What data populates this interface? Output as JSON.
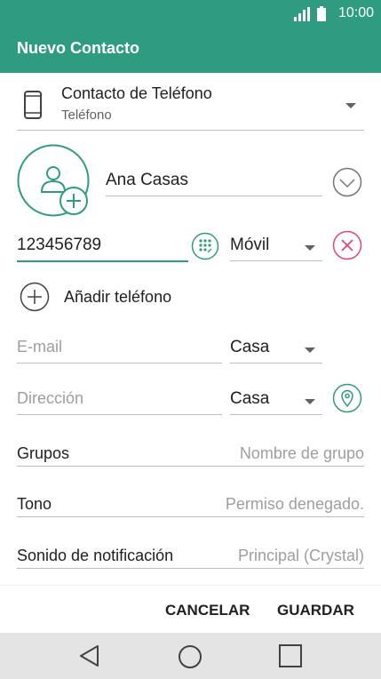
{
  "status": {
    "time": "10:00"
  },
  "appbar": {
    "title": "Nuevo Contacto"
  },
  "account": {
    "title": "Contacto de Teléfono",
    "subtitle": "Teléfono"
  },
  "name": {
    "value": "Ana Casas"
  },
  "phone": {
    "value": "123456789",
    "type": "Móvil"
  },
  "add_phone": {
    "label": "Añadir teléfono"
  },
  "email": {
    "placeholder": "E-mail",
    "type": "Casa"
  },
  "address": {
    "placeholder": "Dirección",
    "type": "Casa"
  },
  "groups": {
    "label": "Grupos",
    "value": "Nombre de grupo"
  },
  "ringtone": {
    "label": "Tono",
    "value": "Permiso denegado."
  },
  "notification": {
    "label": "Sonido de notificación",
    "value": "Principal (Crystal)"
  },
  "actions": {
    "cancel": "CANCELAR",
    "save": "GUARDAR"
  },
  "colors": {
    "accent": "#2f9c82",
    "delete": "#e0457b"
  }
}
